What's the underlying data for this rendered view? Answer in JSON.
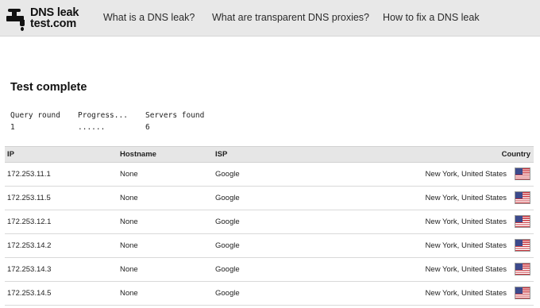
{
  "header": {
    "logo_line1": "DNS leak",
    "logo_line2": "test.com",
    "nav": [
      "What is a DNS leak?",
      "What are transparent DNS proxies?",
      "How to fix a DNS leak"
    ]
  },
  "status": {
    "title": "Test complete",
    "query_round_label": "Query round",
    "query_round_value": "1",
    "progress_label": "Progress...",
    "progress_value": "......",
    "servers_found_label": "Servers found",
    "servers_found_value": "6"
  },
  "table": {
    "headers": [
      "IP",
      "Hostname",
      "ISP",
      "Country"
    ],
    "rows": [
      {
        "ip": "172.253.11.1",
        "hostname": "None",
        "isp": "Google",
        "country": "New York, United States",
        "flag": "us-flag-icon"
      },
      {
        "ip": "172.253.11.5",
        "hostname": "None",
        "isp": "Google",
        "country": "New York, United States",
        "flag": "us-flag-icon"
      },
      {
        "ip": "172.253.12.1",
        "hostname": "None",
        "isp": "Google",
        "country": "New York, United States",
        "flag": "us-flag-icon"
      },
      {
        "ip": "172.253.14.2",
        "hostname": "None",
        "isp": "Google",
        "country": "New York, United States",
        "flag": "us-flag-icon"
      },
      {
        "ip": "172.253.14.3",
        "hostname": "None",
        "isp": "Google",
        "country": "New York, United States",
        "flag": "us-flag-icon"
      },
      {
        "ip": "172.253.14.5",
        "hostname": "None",
        "isp": "Google",
        "country": "New York, United States",
        "flag": "us-flag-icon"
      }
    ]
  }
}
